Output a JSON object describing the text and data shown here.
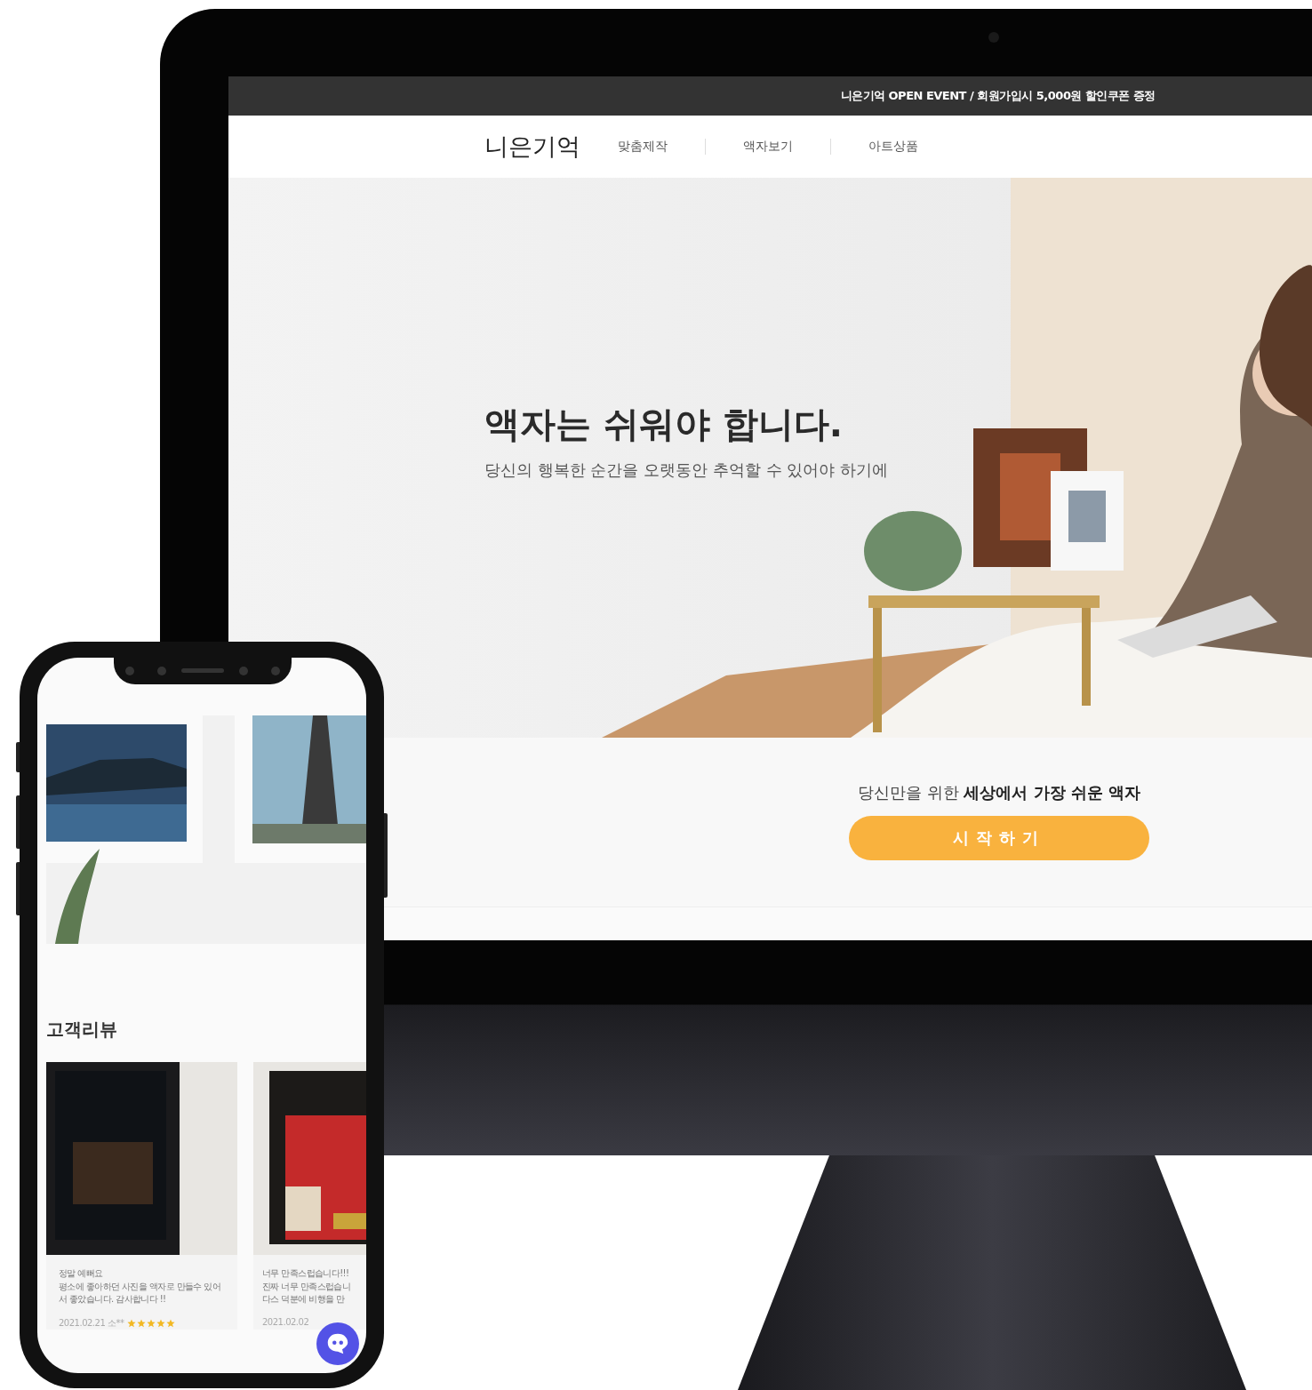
{
  "promo_bar": {
    "text": "니은기억 OPEN EVENT / 회원가입시 5,000원 할인쿠폰 증정"
  },
  "nav": {
    "logo": "니은기억",
    "items": [
      "맞춤제작",
      "액자보기",
      "아트상품"
    ]
  },
  "hero": {
    "kind": "picture",
    "headline": "액자는 쉬워야 합니다.",
    "subline": "당신의 행복한 순간을 오랫동안 추억할 수 있어야 하기에"
  },
  "cta": {
    "tagline": "당신만을 위한 **세상에서 가장 쉬운 액자**",
    "button": "시작하기"
  },
  "mobile": {
    "section_title": "고객리뷰",
    "reviews": [
      {
        "kind": "wide",
        "lines": [
          "정말 예뻐요",
          "평소에 좋아하던 사진을 액자로 만들수 있어서 좋았습니다. 감사합니다 !!"
        ],
        "meta": "2021.02.21 소**",
        "stars": 5
      },
      {
        "kind": "cut",
        "lines": [
          "너무 만족스럽습니다!!!",
          "진짜 너무 만족스럽습니",
          "다스 덕분에 비행을 만"
        ],
        "meta": "2021.02.02"
      }
    ]
  }
}
